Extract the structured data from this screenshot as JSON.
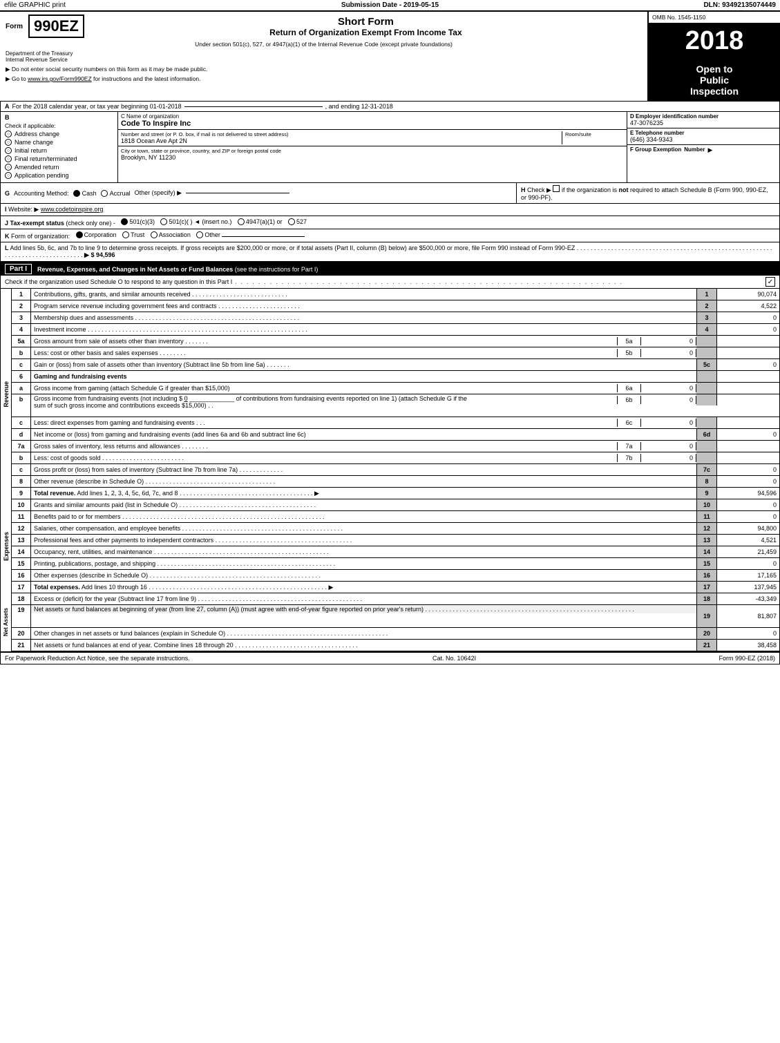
{
  "top_bar": {
    "efile": "efile GRAPHIC print",
    "submission": "Submission Date - 2019-05-15",
    "dln": "DLN: 93492135074449"
  },
  "header": {
    "form_prefix": "Form",
    "form_number": "990EZ",
    "short_form": "Short Form",
    "return_title": "Return of Organization Exempt From Income Tax",
    "under_section": "Under section 501(c), 527, or 4947(a)(1) of the Internal Revenue Code (except private foundations)",
    "dept": "Department of the Treasury",
    "irs": "Internal Revenue Service",
    "note1": "▶ Do not enter social security numbers on this form as it may be made public.",
    "note2": "▶ Go to www.irs.gov/Form990EZ for instructions and the latest information.",
    "omb": "OMB No. 1545-1150",
    "year": "2018",
    "open_to": "Open to",
    "public": "Public",
    "inspection": "Inspection"
  },
  "tax_year": {
    "label_a": "A",
    "text": "For the 2018 calendar year, or tax year beginning 01-01-2018",
    "ending": ", and ending 12-31-2018"
  },
  "section_b": {
    "label": "B",
    "check_applicable": "Check if applicable:",
    "address_change": "Address change",
    "name_change": "Name change",
    "initial_return": "Initial return",
    "final_return": "Final return/terminated",
    "amended_return": "Amended return",
    "application_pending": "Application pending"
  },
  "org_info": {
    "c_label": "C Name of organization",
    "org_name": "Code To Inspire Inc",
    "address_label": "Number and street (or P. O. box, if mail is not delivered to street address)",
    "room_suite_label": "Room/suite",
    "address_value": "1818 Ocean Ave Apt 2N",
    "city_state_label": "City or town, state or province, country, and ZIP or foreign postal code",
    "city_state_value": "Brooklyn, NY  11230",
    "d_label": "D Employer identification number",
    "ein": "47-3076235",
    "e_label": "E Telephone number",
    "phone": "(646) 334-9343",
    "f_label": "F Group Exemption",
    "f_label2": "Number",
    "f_arrow": "▶"
  },
  "section_g": {
    "label": "G",
    "text": "Accounting Method:",
    "cash": "Cash",
    "accrual": "Accrual",
    "other": "Other (specify) ▶",
    "cash_selected": true
  },
  "section_h": {
    "label": "H",
    "text": "Check ▶",
    "text2": "if the organization is",
    "bold": "not",
    "text3": "required to attach Schedule B",
    "text4": "(Form 990, 990-EZ, or 990-PF)."
  },
  "section_i": {
    "label": "I",
    "text": "Website: ▶",
    "url": "www.codetoinspire.org"
  },
  "section_j": {
    "label": "J",
    "text": "Tax-exempt status",
    "check_one": "(check only one) -",
    "option1": "501(c)(3)",
    "option2": "501(c)(",
    "option3": ") ◄ (insert no.)",
    "option4": "4947(a)(1) or",
    "option5": "527",
    "selected": "501(c)(3)"
  },
  "section_k": {
    "label": "K",
    "text": "Form of organization:",
    "corp": "Corporation",
    "trust": "Trust",
    "assoc": "Association",
    "other": "Other",
    "selected": "Corporation"
  },
  "section_l": {
    "label": "L",
    "text": "Add lines 5b, 6c, and 7b to line 9 to determine gross receipts. If gross receipts are $200,000 or more, or if total assets (Part II, column (B) below) are $500,000 or more, file Form 990 instead of Form 990-EZ",
    "dots": ". . . . . . . . . . . . . . . . . . . . . . . . . . . . . . . . . . . . . . . . . . . . . . . . . . . . . . . . . . . . .",
    "arrow": "▶",
    "amount": "$ 94,596"
  },
  "part1": {
    "label": "Part I",
    "title": "Revenue, Expenses, and Changes in Net Assets or Fund Balances",
    "see_instructions": "(see the instructions for Part I)",
    "check_sched_o": "Check if the organization used Schedule O to respond to any question in this Part I",
    "dots": ". . . . . . . . . . . . . . . . . . . . . . . . . . . . . . . . . . . . . . . . . . . . . . . . .",
    "check_mark": "✓"
  },
  "revenue_rows": [
    {
      "num": "1",
      "desc": "Contributions, gifts, grants, and similar amounts received",
      "dots": ". . . . . . . . . . . . . . . . . . . . . . . . . . . .",
      "line_num": "1",
      "amount": "90,074"
    },
    {
      "num": "2",
      "desc": "Program service revenue including government fees and contracts",
      "dots": ". . . . . . . . . . . . . . . . . . . . . . . .",
      "line_num": "2",
      "amount": "4,522"
    },
    {
      "num": "3",
      "desc": "Membership dues and assessments",
      "dots": ". . . . . . . . . . . . . . . . . . . . . . . . . . . . . . . . . . . . . . . . . . . . . . .",
      "line_num": "3",
      "amount": "0"
    },
    {
      "num": "4",
      "desc": "Investment income",
      "dots": ". . . . . . . . . . . . . . . . . . . . . . . . . . . . . . . . . . . . . . . . . . . . . . . . . . . . . . . . . . . . . . . .",
      "line_num": "4",
      "amount": "0"
    },
    {
      "num": "5a",
      "desc": "Gross amount from sale of assets other than inventory",
      "dots": ". . . . . . .",
      "label": "5a",
      "input": "0"
    },
    {
      "num": "b",
      "desc": "Less: cost or other basis and sales expenses",
      "dots": ". . . . . . . .",
      "label": "5b",
      "input": "0"
    },
    {
      "num": "c",
      "desc": "Gain or (loss) from sale of assets other than inventory (Subtract line 5b from line 5a)",
      "dots": ". . . . . . .",
      "line_num": "5c",
      "amount": "0"
    },
    {
      "num": "6",
      "desc": "Gaming and fundraising events"
    },
    {
      "num": "a",
      "desc": "Gross income from gaming (attach Schedule G if greater than $15,000)",
      "label": "6a",
      "input": "0"
    },
    {
      "num": "b",
      "desc": "Gross income from fundraising events (not including $",
      "desc2": " 0",
      "desc3": " of contributions from fundraising events reported on line 1) (attach Schedule G if the sum of such gross income and contributions exceeds $15,000)",
      "label": "6b",
      "input": "0",
      "dots": ". ."
    },
    {
      "num": "c",
      "desc": "Less: direct expenses from gaming and fundraising events",
      "dots": ". . .",
      "label": "6c",
      "input": "0"
    },
    {
      "num": "d",
      "desc": "Net income or (loss) from gaming and fundraising events (add lines 6a and 6b and subtract line 6c)",
      "line_num": "6d",
      "amount": "0"
    },
    {
      "num": "7a",
      "desc": "Gross sales of inventory, less returns and allowances",
      "dots": ". . . . . . . .",
      "label": "7a",
      "input": "0"
    },
    {
      "num": "b",
      "desc": "Less: cost of goods sold",
      "dots": ". . . . . . . . . . . . . . . . . . . . . . . .",
      "label": "7b",
      "input": "0"
    },
    {
      "num": "c",
      "desc": "Gross profit or (loss) from sales of inventory (Subtract line 7b from line 7a)",
      "dots": ". . . . . . . . . . . . .",
      "line_num": "7c",
      "amount": "0"
    },
    {
      "num": "8",
      "desc": "Other revenue (describe in Schedule O)",
      "dots": ". . . . . . . . . . . . . . . . . . . . . . . . . . . . . . . . . . . . . .",
      "line_num": "8",
      "amount": "0"
    },
    {
      "num": "9",
      "desc": "Total revenue.",
      "desc2": " Add lines 1, 2, 3, 4, 5c, 6d, 7c, and 8",
      "dots": ". . . . . . . . . . . . . . . . . . . . . . . . . . . . . . . . . . . . . . .",
      "arrow": "▶",
      "line_num": "9",
      "amount": "94,596",
      "bold": true
    }
  ],
  "expense_rows": [
    {
      "num": "10",
      "desc": "Grants and similar amounts paid (list in Schedule O)",
      "dots": ". . . . . . . . . . . . . . . . . . . . . . . . . . . . . . . . . . . . . . . .",
      "line_num": "10",
      "amount": "0"
    },
    {
      "num": "11",
      "desc": "Benefits paid to or for members",
      "dots": ". . . . . . . . . . . . . . . . . . . . . . . . . . . . . . . . . . . . . . . . . . . . . . . . . . . . . . . . . . . .",
      "line_num": "11",
      "amount": "0"
    },
    {
      "num": "12",
      "desc": "Salaries, other compensation, and employee benefits",
      "dots": ". . . . . . . . . . . . . . . . . . . . . . . . . . . . . . . . . . . . . . . . . . . . . .",
      "line_num": "12",
      "amount": "94,800"
    },
    {
      "num": "13",
      "desc": "Professional fees and other payments to independent contractors",
      "dots": ". . . . . . . . . . . . . . . . . . . . . . . . . . . . . . . . . . . . . . . . .",
      "line_num": "13",
      "amount": "4,521"
    },
    {
      "num": "14",
      "desc": "Occupancy, rent, utilities, and maintenance",
      "dots": ". . . . . . . . . . . . . . . . . . . . . . . . . . . . . . . . . . . . . . . . . . . . . . . . . . . . .",
      "line_num": "14",
      "amount": "21,459"
    },
    {
      "num": "15",
      "desc": "Printing, publications, postage, and shipping",
      "dots": ". . . . . . . . . . . . . . . . . . . . . . . . . . . . . . . . . . . . . . . . . . . . . . . . . . . . . . . . . .",
      "line_num": "15",
      "amount": "0"
    },
    {
      "num": "16",
      "desc": "Other expenses (describe in Schedule O)",
      "dots": ". . . . . . . . . . . . . . . . . . . . . . . . . . . . . . . . . . . . . . . . . . . . . . . . . . .",
      "line_num": "16",
      "amount": "17,165"
    },
    {
      "num": "17",
      "desc": "Total expenses.",
      "desc2": " Add lines 10 through 16",
      "dots": ". . . . . . . . . . . . . . . . . . . . . . . . . . . . . . . . . . . . . . . . . . . . . . . . . . . . .",
      "arrow": "▶",
      "line_num": "17",
      "amount": "137,945",
      "bold": true
    }
  ],
  "net_assets_rows": [
    {
      "num": "18",
      "desc": "Excess or (deficit) for the year (Subtract line 17 from line 9)",
      "dots": ". . . . . . . . . . . . . . . . . . . . . . . . . . . . . . . . . . . . . . . . . . . . . . . .",
      "line_num": "18",
      "amount": "-43,349"
    },
    {
      "num": "19",
      "desc": "Net assets or fund balances at beginning of year (from line 27, column (A)) (must agree with end-of-year figure reported on prior year's return)",
      "dots": ". . . . . . . . . . . . . . . . . . . . . . . . . . . . . . . . . . . . . . . . . . . . . . . . . . . . . . . . . . . . . .",
      "line_num": "19",
      "amount": "81,807",
      "highlight": true
    },
    {
      "num": "20",
      "desc": "Other changes in net assets or fund balances (explain in Schedule O)",
      "dots": ". . . . . . . . . . . . . . . . . . . . . . . . . . . . . . . . . . . . . . . . . . . . . . .",
      "line_num": "20",
      "amount": "0"
    },
    {
      "num": "21",
      "desc": "Net assets or fund balances at end of year. Combine lines 18 through 20",
      "dots": ". . . . . . . . . . . . . . . . . . . . . . . . . . . . . . . . . . . .",
      "line_num": "21",
      "amount": "38,458"
    }
  ],
  "footer": {
    "left": "For Paperwork Reduction Act Notice, see the separate instructions.",
    "cat": "Cat. No. 10642I",
    "right": "Form 990-EZ (2018)"
  }
}
